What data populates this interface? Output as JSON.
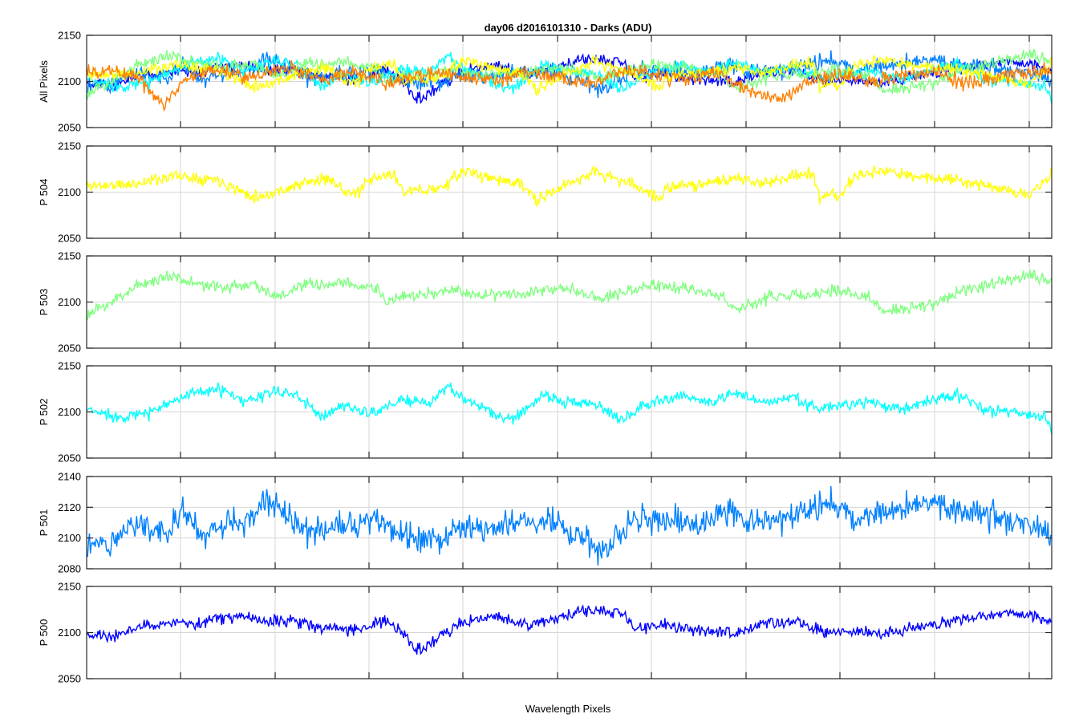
{
  "title": "day06 d2016101310 - Darks (ADU)",
  "xlabel": "Wavelength Pixels",
  "chart_data": {
    "type": "line",
    "title": "day06 d2016101310 - Darks (ADU)",
    "xlabel": "Wavelength Pixels",
    "grid": true,
    "n_points": 1024,
    "panels": [
      {
        "ylabel": "All Pixels",
        "ylim": [
          2050,
          2150
        ],
        "yticks": [
          "2150",
          "2100",
          "2050"
        ],
        "yticks_values": [
          2150,
          2100,
          2050
        ],
        "series": [
          "P 500",
          "P 501",
          "P 502",
          "P 503",
          "P 504",
          "all-orange"
        ]
      },
      {
        "ylabel": "P 504",
        "ylim": [
          2050,
          2150
        ],
        "yticks": [
          "2150",
          "2100",
          "2050"
        ],
        "yticks_values": [
          2150,
          2100,
          2050
        ],
        "series": [
          "P 504"
        ]
      },
      {
        "ylabel": "P 503",
        "ylim": [
          2050,
          2150
        ],
        "yticks": [
          "2150",
          "2100",
          "2050"
        ],
        "yticks_values": [
          2150,
          2100,
          2050
        ],
        "series": [
          "P 503"
        ]
      },
      {
        "ylabel": "P 502",
        "ylim": [
          2050,
          2150
        ],
        "yticks": [
          "2150",
          "2100",
          "2050"
        ],
        "yticks_values": [
          2150,
          2100,
          2050
        ],
        "series": [
          "P 502"
        ]
      },
      {
        "ylabel": "P 501",
        "ylim": [
          2080,
          2140
        ],
        "yticks": [
          "2140",
          "2120",
          "2100",
          "2080"
        ],
        "yticks_values": [
          2140,
          2120,
          2100,
          2080
        ],
        "series": [
          "P 501"
        ]
      },
      {
        "ylabel": "P 500",
        "ylim": [
          2050,
          2150
        ],
        "yticks": [
          "2150",
          "2100",
          "2050"
        ],
        "yticks_values": [
          2150,
          2100,
          2050
        ],
        "series": [
          "P 500"
        ]
      }
    ],
    "series": [
      {
        "name": "P 504",
        "color": "#ffff00",
        "mean": 2108,
        "noise": 5,
        "control": [
          [
            0,
            2107
          ],
          [
            60,
            2108
          ],
          [
            120,
            2118
          ],
          [
            180,
            2114
          ],
          [
            220,
            2098
          ],
          [
            240,
            2095
          ],
          [
            300,
            2110
          ],
          [
            340,
            2115
          ],
          [
            350,
            2103
          ],
          [
            370,
            2097
          ],
          [
            390,
            2112
          ],
          [
            420,
            2120
          ],
          [
            440,
            2100
          ],
          [
            490,
            2105
          ],
          [
            520,
            2123
          ],
          [
            560,
            2115
          ],
          [
            600,
            2108
          ],
          [
            620,
            2090
          ],
          [
            660,
            2108
          ],
          [
            700,
            2122
          ],
          [
            760,
            2106
          ],
          [
            790,
            2093
          ],
          [
            800,
            2104
          ],
          [
            850,
            2110
          ],
          [
            890,
            2114
          ],
          [
            940,
            2110
          ],
          [
            970,
            2118
          ],
          [
            1000,
            2121
          ],
          [
            1010,
            2093
          ],
          [
            1040,
            2098
          ],
          [
            1060,
            2118
          ],
          [
            1100,
            2123
          ],
          [
            1150,
            2116
          ],
          [
            1180,
            2115
          ],
          [
            1200,
            2114
          ],
          [
            1210,
            2112
          ],
          [
            1250,
            2106
          ],
          [
            1300,
            2096
          ],
          [
            1330,
            2120
          ]
        ]
      },
      {
        "name": "P 503",
        "color": "#80ff80",
        "mean": 2108,
        "noise": 5,
        "control": [
          [
            0,
            2085
          ],
          [
            30,
            2100
          ],
          [
            60,
            2118
          ],
          [
            100,
            2128
          ],
          [
            105,
            2130
          ],
          [
            120,
            2122
          ],
          [
            160,
            2115
          ],
          [
            200,
            2120
          ],
          [
            230,
            2105
          ],
          [
            260,
            2118
          ],
          [
            310,
            2120
          ],
          [
            350,
            2115
          ],
          [
            360,
            2100
          ],
          [
            400,
            2108
          ],
          [
            440,
            2112
          ],
          [
            480,
            2108
          ],
          [
            520,
            2110
          ],
          [
            560,
            2114
          ],
          [
            580,
            2115
          ],
          [
            620,
            2105
          ],
          [
            650,
            2112
          ],
          [
            680,
            2118
          ],
          [
            720,
            2115
          ],
          [
            760,
            2108
          ],
          [
            780,
            2092
          ],
          [
            820,
            2105
          ],
          [
            860,
            2108
          ],
          [
            900,
            2112
          ],
          [
            940,
            2105
          ],
          [
            960,
            2090
          ],
          [
            1000,
            2095
          ],
          [
            1020,
            2098
          ],
          [
            1060,
            2115
          ],
          [
            1100,
            2122
          ],
          [
            1130,
            2128
          ],
          [
            1160,
            2125
          ]
        ]
      },
      {
        "name": "P 502",
        "color": "#00ffff",
        "mean": 2106,
        "noise": 5,
        "control": [
          [
            0,
            2102
          ],
          [
            40,
            2095
          ],
          [
            80,
            2098
          ],
          [
            100,
            2110
          ],
          [
            140,
            2120
          ],
          [
            170,
            2125
          ],
          [
            200,
            2110
          ],
          [
            230,
            2120
          ],
          [
            260,
            2122
          ],
          [
            300,
            2095
          ],
          [
            330,
            2108
          ],
          [
            360,
            2098
          ],
          [
            400,
            2112
          ],
          [
            440,
            2110
          ],
          [
            460,
            2128
          ],
          [
            490,
            2110
          ],
          [
            540,
            2090
          ],
          [
            580,
            2118
          ],
          [
            610,
            2110
          ],
          [
            640,
            2112
          ],
          [
            680,
            2092
          ],
          [
            720,
            2112
          ],
          [
            760,
            2118
          ],
          [
            790,
            2110
          ],
          [
            830,
            2120
          ],
          [
            860,
            2110
          ],
          [
            900,
            2118
          ],
          [
            930,
            2102
          ],
          [
            960,
            2108
          ],
          [
            1000,
            2110
          ],
          [
            1040,
            2102
          ],
          [
            1080,
            2115
          ],
          [
            1110,
            2118
          ],
          [
            1150,
            2102
          ],
          [
            1190,
            2098
          ],
          [
            1220,
            2095
          ],
          [
            1230,
            2080
          ]
        ]
      },
      {
        "name": "P 501",
        "color": "#0080ff",
        "mean": 2108,
        "noise": 7,
        "control": [
          [
            0,
            2096
          ],
          [
            30,
            2097
          ],
          [
            60,
            2110
          ],
          [
            100,
            2105
          ],
          [
            120,
            2120
          ],
          [
            140,
            2100
          ],
          [
            180,
            2110
          ],
          [
            200,
            2112
          ],
          [
            220,
            2125
          ],
          [
            250,
            2115
          ],
          [
            280,
            2102
          ],
          [
            320,
            2108
          ],
          [
            360,
            2112
          ],
          [
            400,
            2100
          ],
          [
            440,
            2098
          ],
          [
            460,
            2108
          ],
          [
            500,
            2105
          ],
          [
            540,
            2110
          ],
          [
            580,
            2112
          ],
          [
            600,
            2102
          ],
          [
            620,
            2100
          ],
          [
            640,
            2092
          ],
          [
            680,
            2110
          ],
          [
            720,
            2112
          ],
          [
            760,
            2108
          ],
          [
            800,
            2118
          ],
          [
            840,
            2108
          ],
          [
            880,
            2115
          ],
          [
            920,
            2125
          ],
          [
            960,
            2112
          ],
          [
            1000,
            2118
          ],
          [
            1040,
            2124
          ],
          [
            1080,
            2118
          ],
          [
            1120,
            2115
          ],
          [
            1160,
            2110
          ],
          [
            1190,
            2105
          ],
          [
            1200,
            2100
          ]
        ]
      },
      {
        "name": "P 500",
        "color": "#0000ff",
        "mean": 2108,
        "noise": 5,
        "control": [
          [
            0,
            2098
          ],
          [
            30,
            2095
          ],
          [
            60,
            2105
          ],
          [
            100,
            2110
          ],
          [
            140,
            2108
          ],
          [
            160,
            2115
          ],
          [
            200,
            2118
          ],
          [
            230,
            2112
          ],
          [
            260,
            2114
          ],
          [
            290,
            2108
          ],
          [
            320,
            2104
          ],
          [
            350,
            2104
          ],
          [
            380,
            2112
          ],
          [
            400,
            2102
          ],
          [
            420,
            2080
          ],
          [
            450,
            2095
          ],
          [
            480,
            2112
          ],
          [
            520,
            2118
          ],
          [
            560,
            2108
          ],
          [
            600,
            2115
          ],
          [
            640,
            2125
          ],
          [
            680,
            2122
          ],
          [
            700,
            2104
          ],
          [
            740,
            2108
          ],
          [
            780,
            2102
          ],
          [
            820,
            2098
          ],
          [
            860,
            2110
          ],
          [
            900,
            2112
          ],
          [
            940,
            2100
          ],
          [
            980,
            2102
          ],
          [
            1020,
            2098
          ],
          [
            1060,
            2106
          ],
          [
            1100,
            2112
          ],
          [
            1140,
            2118
          ],
          [
            1180,
            2122
          ],
          [
            1220,
            2115
          ],
          [
            1230,
            2112
          ]
        ]
      },
      {
        "name": "all-orange",
        "color": "#ff8000",
        "mean": 2108,
        "noise": 6,
        "control": [
          [
            0,
            2110
          ],
          [
            30,
            2112
          ],
          [
            60,
            2108
          ],
          [
            80,
            2090
          ],
          [
            100,
            2075
          ],
          [
            120,
            2098
          ],
          [
            160,
            2115
          ],
          [
            200,
            2105
          ],
          [
            260,
            2115
          ],
          [
            300,
            2102
          ],
          [
            340,
            2112
          ],
          [
            380,
            2098
          ],
          [
            440,
            2110
          ],
          [
            480,
            2105
          ],
          [
            520,
            2100
          ],
          [
            560,
            2110
          ],
          [
            600,
            2104
          ],
          [
            640,
            2098
          ],
          [
            680,
            2112
          ],
          [
            720,
            2108
          ],
          [
            760,
            2102
          ],
          [
            800,
            2110
          ],
          [
            840,
            2092
          ],
          [
            880,
            2080
          ],
          [
            920,
            2100
          ],
          [
            960,
            2108
          ],
          [
            1000,
            2100
          ],
          [
            1040,
            2106
          ],
          [
            1080,
            2110
          ],
          [
            1120,
            2098
          ],
          [
            1160,
            2105
          ],
          [
            1200,
            2110
          ],
          [
            1230,
            2112
          ]
        ]
      }
    ]
  }
}
